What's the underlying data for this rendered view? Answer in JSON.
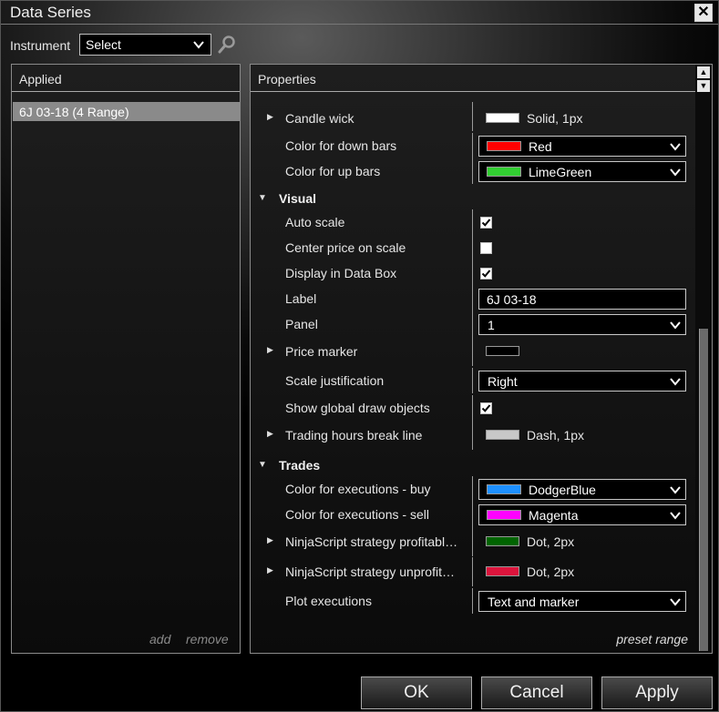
{
  "window": {
    "title": "Data Series"
  },
  "instrument": {
    "label": "Instrument",
    "selected": "Select"
  },
  "applied": {
    "header": "Applied",
    "items": [
      "6J 03-18 (4 Range)"
    ],
    "add_label": "add",
    "remove_label": "remove"
  },
  "properties": {
    "header": "Properties",
    "preset_label": "preset range",
    "rows": {
      "candle_wick": {
        "label": "Candle wick",
        "value": "Solid, 1px",
        "color": "#ffffff"
      },
      "down_bars": {
        "label": "Color for down bars",
        "value": "Red",
        "color": "#ff0000"
      },
      "up_bars": {
        "label": "Color for up bars",
        "value": "LimeGreen",
        "color": "#32cd32"
      },
      "visual": {
        "label": "Visual"
      },
      "auto_scale": {
        "label": "Auto scale",
        "checked": true
      },
      "center_price": {
        "label": "Center price on scale",
        "checked": false
      },
      "display_data_box": {
        "label": "Display in Data Box",
        "checked": true
      },
      "label_row": {
        "label": "Label",
        "value": "6J 03-18"
      },
      "panel": {
        "label": "Panel",
        "value": "1"
      },
      "price_marker": {
        "label": "Price marker",
        "color": "#000000"
      },
      "scale_justification": {
        "label": "Scale justification",
        "value": "Right"
      },
      "global_draw": {
        "label": "Show global draw objects",
        "checked": true
      },
      "trading_hours": {
        "label": "Trading hours break line",
        "value": "Dash, 1px",
        "color": "#c8c8c8"
      },
      "trades": {
        "label": "Trades"
      },
      "exec_buy": {
        "label": "Color for executions - buy",
        "value": "DodgerBlue",
        "color": "#1e90ff"
      },
      "exec_sell": {
        "label": "Color for executions - sell",
        "value": "Magenta",
        "color": "#ff00ff"
      },
      "ns_profitable": {
        "label": "NinjaScript strategy profitabl…",
        "value": "Dot, 2px",
        "color": "#006400"
      },
      "ns_unprofitable": {
        "label": "NinjaScript strategy unprofit…",
        "value": "Dot, 2px",
        "color": "#dc143c"
      },
      "plot_exec": {
        "label": "Plot executions",
        "value": "Text and marker"
      }
    }
  },
  "buttons": {
    "ok": "OK",
    "cancel": "Cancel",
    "apply": "Apply"
  }
}
